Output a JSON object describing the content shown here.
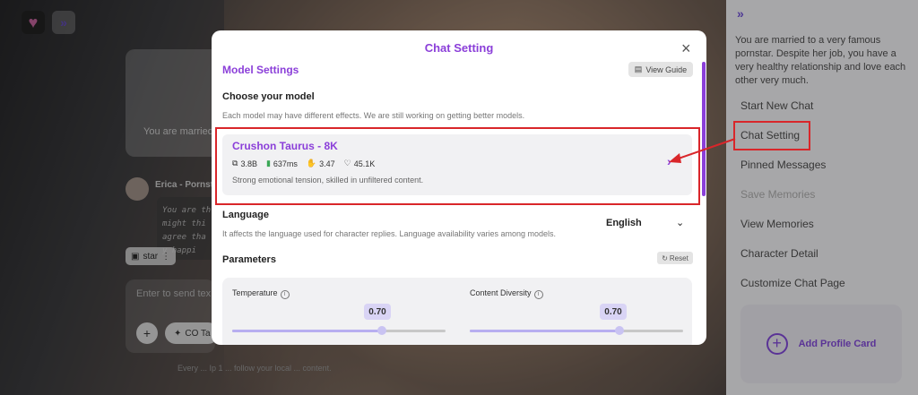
{
  "background": {
    "intro_text": "You are married",
    "character_name": "Erica - Pornsta",
    "message_text": "You are th might thi agree tha y happi",
    "star_chip": "star",
    "input_placeholder": "Enter to send tex",
    "co_button": "CO Ta",
    "footer_note": "Every ... Ip 1 ... follow your local ... content."
  },
  "sidebar": {
    "description": "You are married to a very famous pornstar. Despite her job, you have a very healthy relationship and love each other very much.",
    "items": [
      {
        "label": "Start New Chat",
        "enabled": true
      },
      {
        "label": "Chat Setting",
        "enabled": true
      },
      {
        "label": "Pinned Messages",
        "enabled": true
      },
      {
        "label": "Save Memories",
        "enabled": false
      },
      {
        "label": "View Memories",
        "enabled": true
      },
      {
        "label": "Character Detail",
        "enabled": true
      },
      {
        "label": "Customize Chat Page",
        "enabled": true
      }
    ],
    "profile_card_label": "Add Profile Card"
  },
  "modal": {
    "title": "Chat Setting",
    "close_label": "×",
    "model_settings_title": "Model Settings",
    "view_guide_label": "View Guide",
    "choose_model_label": "Choose your model",
    "choose_model_hint": "Each model may have different effects. We are still working on getting better models.",
    "model": {
      "name": "Crushon Taurus - 8K",
      "stats": {
        "size": "3.8B",
        "latency": "637ms",
        "rating": "3.47",
        "likes": "45.1K"
      },
      "description": "Strong emotional tension, skilled in unfiltered content."
    },
    "language_label": "Language",
    "language_hint": "It affects the language used for character replies. Language availability varies among models.",
    "language_value": "English",
    "parameters_label": "Parameters",
    "reset_label": "Reset",
    "parameters": [
      {
        "label": "Temperature",
        "value": "0.70",
        "level": 0.7
      },
      {
        "label": "Content Diversity",
        "value": "0.70",
        "level": 0.7
      }
    ]
  },
  "colors": {
    "accent": "#8b3fd9",
    "annotation": "#d9262a"
  },
  "icons": [
    "heart-logo-icon",
    "expand-icon",
    "close-icon",
    "guide-icon",
    "model-size-icon",
    "signal-icon",
    "rating-icon",
    "heart-icon",
    "chevron-right-icon",
    "chevron-down-icon",
    "reset-icon",
    "info-icon",
    "plus-icon",
    "sparkle-icon"
  ]
}
